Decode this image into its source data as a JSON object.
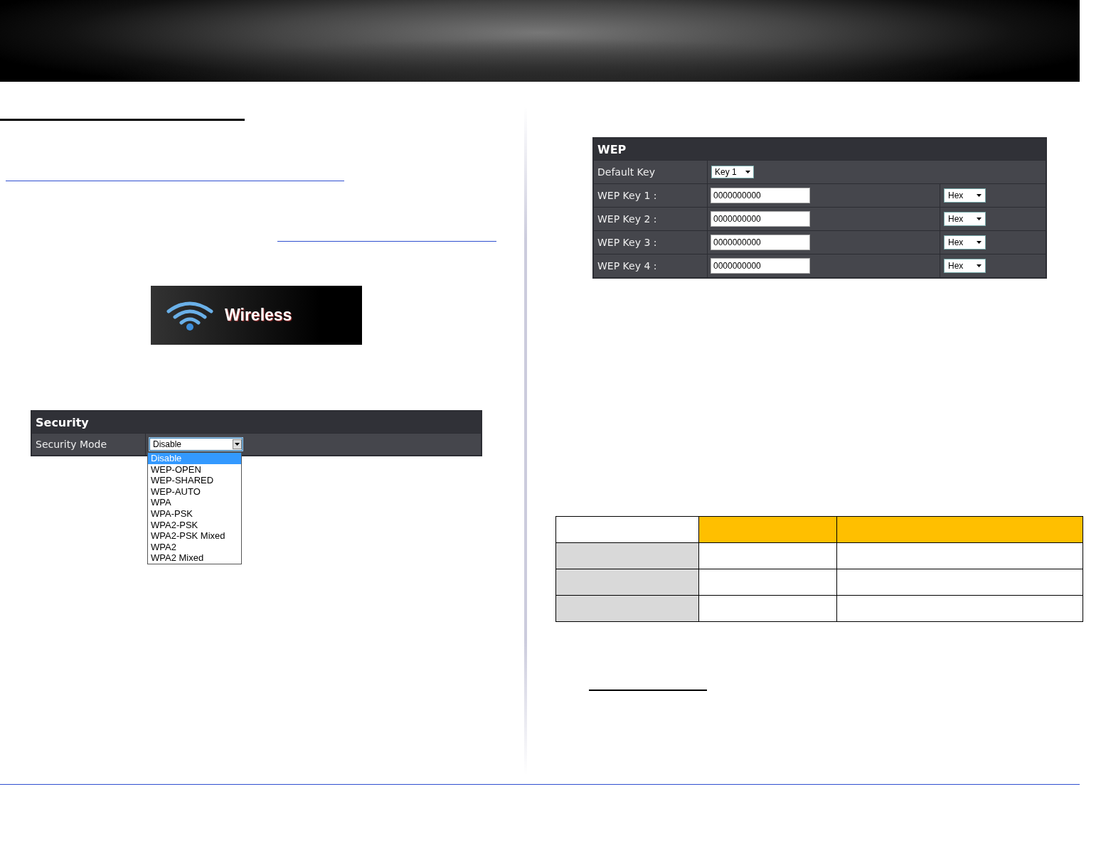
{
  "wireless_tile": {
    "label": "Wireless"
  },
  "security_panel": {
    "title": "Security",
    "mode": {
      "label": "Security Mode",
      "value": "Disable",
      "expanded": true,
      "options": [
        {
          "label": "Disable",
          "selected": true
        },
        {
          "label": "WEP-OPEN",
          "selected": false
        },
        {
          "label": "WEP-SHARED",
          "selected": false
        },
        {
          "label": "WEP-AUTO",
          "selected": false
        },
        {
          "label": "WPA",
          "selected": false
        },
        {
          "label": "WPA-PSK",
          "selected": false
        },
        {
          "label": "WPA2-PSK",
          "selected": false
        },
        {
          "label": "WPA2-PSK Mixed",
          "selected": false
        },
        {
          "label": "WPA2",
          "selected": false
        },
        {
          "label": "WPA2 Mixed",
          "selected": false
        }
      ]
    }
  },
  "wep_panel": {
    "title": "WEP",
    "default_key": {
      "label": "Default Key",
      "value": "Key 1"
    },
    "keys": [
      {
        "label": "WEP Key 1 :",
        "value": "0000000000",
        "format": "Hex"
      },
      {
        "label": "WEP Key 2 :",
        "value": "0000000000",
        "format": "Hex"
      },
      {
        "label": "WEP Key 3 :",
        "value": "0000000000",
        "format": "Hex"
      },
      {
        "label": "WEP Key 4 :",
        "value": "0000000000",
        "format": "Hex"
      }
    ]
  }
}
